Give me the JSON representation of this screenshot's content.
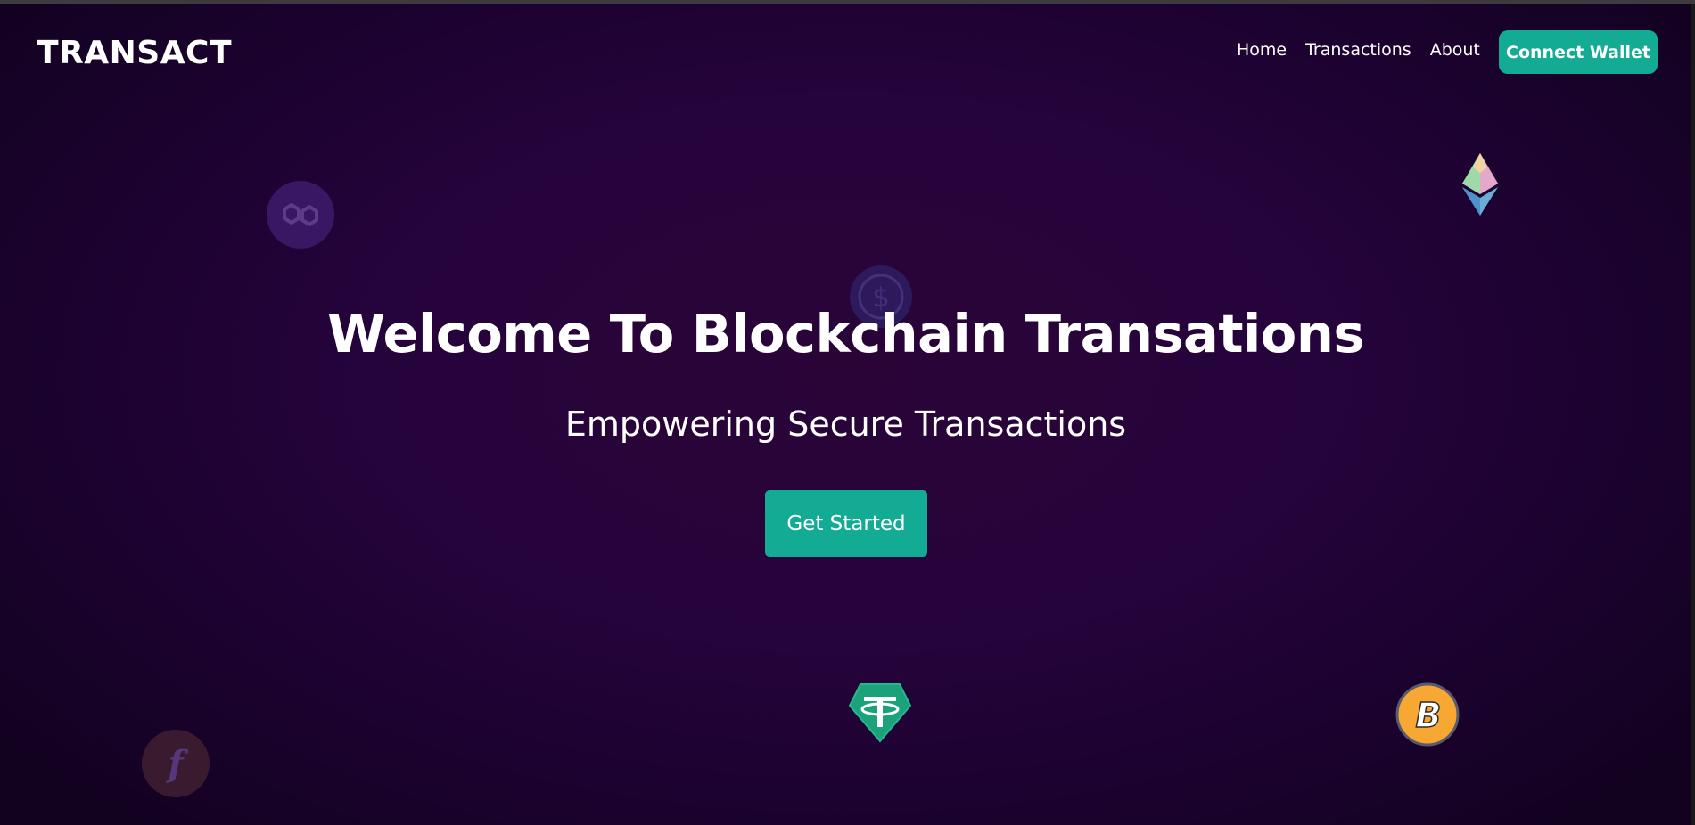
{
  "navbar": {
    "logo": "TRANSACT",
    "links": [
      {
        "label": "Home"
      },
      {
        "label": "Transactions"
      },
      {
        "label": "About"
      }
    ],
    "connect_label": "Connect Wallet"
  },
  "hero": {
    "title": "Welcome To Blockchain Transations",
    "subtitle": "Empowering Secure Transactions",
    "cta_label": "Get Started"
  },
  "floating_icons": [
    {
      "name": "polygon-icon",
      "color": "#3b1763"
    },
    {
      "name": "usdc-icon",
      "color": "#2b1c5a"
    },
    {
      "name": "ethereum-icon",
      "color": "#8a92b2"
    },
    {
      "name": "tether-icon",
      "color": "#1ba27a"
    },
    {
      "name": "bitcoin-icon",
      "color": "#f7a833"
    },
    {
      "name": "filecoin-icon",
      "color": "#3a1a2e"
    }
  ],
  "colors": {
    "accent": "#13ab93",
    "background": "#25033b",
    "text": "#ffffff"
  }
}
